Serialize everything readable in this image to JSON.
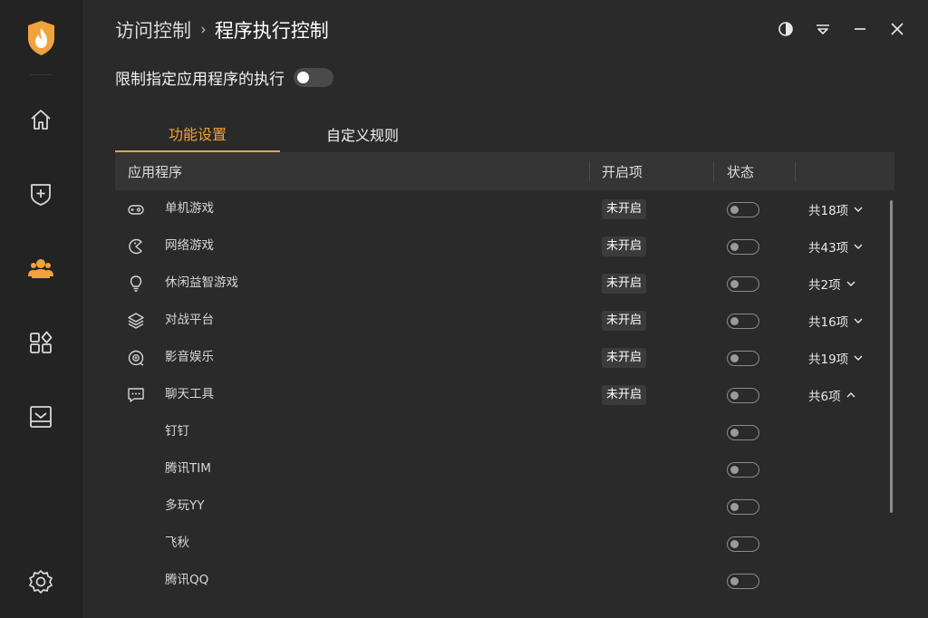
{
  "header": {
    "breadcrumb_parent": "访问控制",
    "breadcrumb_separator": "›",
    "breadcrumb_current": "程序执行控制"
  },
  "master": {
    "label": "限制指定应用程序的执行",
    "enabled": false
  },
  "tabs": [
    {
      "label": "功能设置",
      "active": true
    },
    {
      "label": "自定义规则",
      "active": false
    }
  ],
  "table": {
    "columns": [
      "应用程序",
      "开启项",
      "状态"
    ],
    "rows": [
      {
        "icon": "gamepad-icon",
        "name": "单机游戏",
        "badge": "未开启",
        "count": "共18项",
        "expanded": false
      },
      {
        "icon": "pacman-icon",
        "name": "网络游戏",
        "badge": "未开启",
        "count": "共43项",
        "expanded": false
      },
      {
        "icon": "lightbulb-icon",
        "name": "休闲益智游戏",
        "badge": "未开启",
        "count": "共2项",
        "expanded": false
      },
      {
        "icon": "layers-icon",
        "name": "对战平台",
        "badge": "未开启",
        "count": "共16项",
        "expanded": false
      },
      {
        "icon": "media-icon",
        "name": "影音娱乐",
        "badge": "未开启",
        "count": "共19项",
        "expanded": false
      },
      {
        "icon": "chat-icon",
        "name": "聊天工具",
        "badge": "未开启",
        "count": "共6项",
        "expanded": true
      }
    ],
    "subrows": [
      {
        "name": "钉钉"
      },
      {
        "name": "腾讯TIM"
      },
      {
        "name": "多玩YY"
      },
      {
        "name": "飞秋"
      },
      {
        "name": "腾讯QQ"
      }
    ]
  },
  "colors": {
    "accent": "#f0a33c",
    "background": "#2a2a2a",
    "sidebar": "#232323"
  },
  "sidebar_icons": [
    "home-icon",
    "shield-plus-icon",
    "users-icon",
    "apps-icon",
    "tray-icon",
    "settings-icon"
  ]
}
